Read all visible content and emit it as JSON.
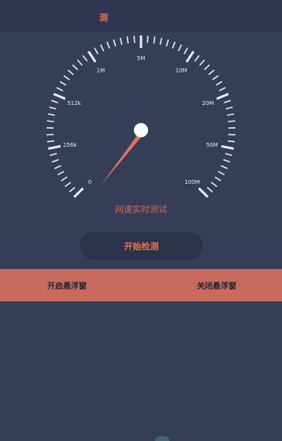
{
  "header": {
    "title": "测"
  },
  "gauge": {
    "scale_labels": [
      "0",
      "256k",
      "512k",
      "1M",
      "5M",
      "10M",
      "20M",
      "50M",
      "100M"
    ],
    "caption": "网速实时测试",
    "needle_value_label": "0",
    "colors": {
      "accent": "#e5735a",
      "ticks": "#e8ebf5",
      "background": "#363d59"
    }
  },
  "actions": {
    "start_label": "开始检测",
    "open_float_label": "开启悬浮窗",
    "close_float_label": "关闭悬浮窗"
  }
}
